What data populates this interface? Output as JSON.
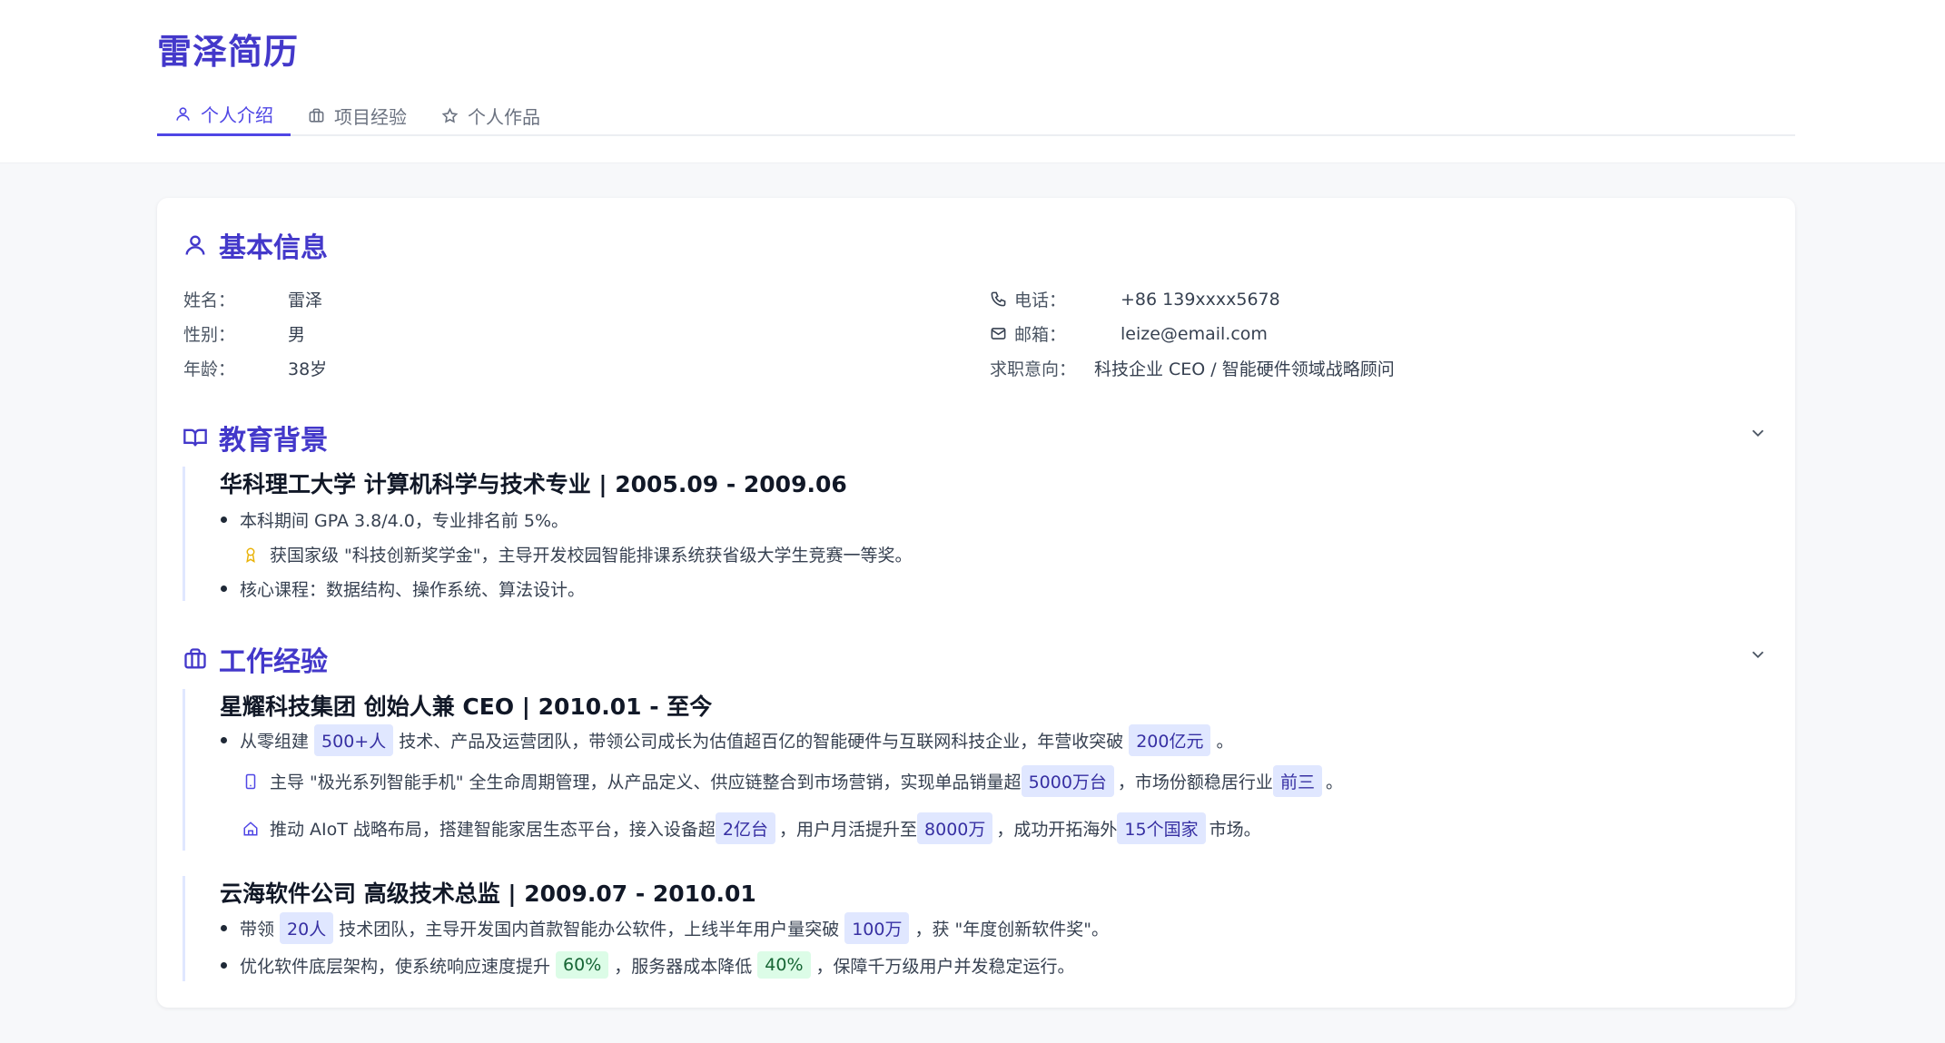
{
  "app": {
    "title": "雷泽简历"
  },
  "tabs": [
    {
      "label": "个人介绍",
      "icon": "user-icon",
      "active": true
    },
    {
      "label": "项目经验",
      "icon": "briefcase-icon",
      "active": false
    },
    {
      "label": "个人作品",
      "icon": "star-icon",
      "active": false
    }
  ],
  "colors": {
    "accent": "#4f46e5",
    "title": "#4338ca",
    "chip_blue": "#e0e7ff",
    "chip_green": "#dcfce7",
    "award": "#eab308"
  },
  "basic": {
    "title": "基本信息",
    "name_label": "姓名：",
    "name": "雷泽",
    "gender_label": "性别：",
    "gender": "男",
    "age_label": "年龄：",
    "age": "38岁",
    "phone_label": "电话：",
    "phone": "+86 139xxxx5678",
    "email_label": "邮箱：",
    "email": "leize@email.com",
    "intent_label": "求职意向：",
    "intent": "科技企业 CEO / 智能硬件领域战略顾问"
  },
  "education": {
    "title": "教育背景",
    "entry_title": "华科理工大学 计算机科学与技术专业 | 2005.09 - 2009.06",
    "gpa": "本科期间 GPA 3.8/4.0，专业排名前 5%。",
    "award": "获国家级 \"科技创新奖学金\"，主导开发校园智能排课系统获省级大学生竞赛一等奖。",
    "courses": "核心课程：数据结构、操作系统、算法设计。"
  },
  "work": {
    "title": "工作经验",
    "job1": {
      "title": "星耀科技集团 创始人兼 CEO | 2010.01 - 至今",
      "l1_a": "从零组建",
      "l1_chip1": "500+人",
      "l1_b": "技术、产品及运营团队，带领公司成长为估值超百亿的智能硬件与互联网科技企业，年营收突破",
      "l1_chip2": "200亿元",
      "l1_c": "。",
      "l2_a": "主导 \"极光系列智能手机\" 全生命周期管理，从产品定义、供应链整合到市场营销，实现单品销量超",
      "l2_chip1": "5000万台",
      "l2_b": "，市场份额稳居行业",
      "l2_chip2": "前三",
      "l2_c": "。",
      "l3_a": "推动 AIoT 战略布局，搭建智能家居生态平台，接入设备超",
      "l3_chip1": "2亿台",
      "l3_b": "，用户月活提升至",
      "l3_chip2": "8000万",
      "l3_c": "，成功开拓海外",
      "l3_chip3": "15个国家",
      "l3_d": "市场。"
    },
    "job2": {
      "title": "云海软件公司 高级技术总监 | 2009.07 - 2010.01",
      "l1_a": "带领",
      "l1_chip1": "20人",
      "l1_b": "技术团队，主导开发国内首款智能办公软件，上线半年用户量突破",
      "l1_chip2": "100万",
      "l1_c": "，获 \"年度创新软件奖\"。",
      "l2_a": "优化软件底层架构，使系统响应速度提升",
      "l2_chip1": "60%",
      "l2_b": "，服务器成本降低",
      "l2_chip2": "40%",
      "l2_c": "，保障千万级用户并发稳定运行。"
    }
  }
}
